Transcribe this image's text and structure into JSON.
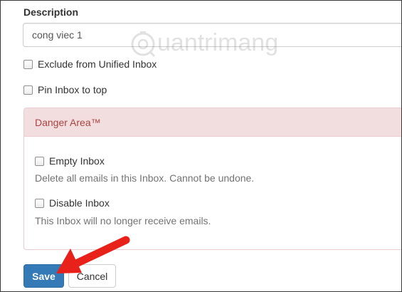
{
  "form": {
    "description_label": "Description",
    "description_value": "cong viec 1",
    "exclude_label": "Exclude from Unified Inbox",
    "pin_label": "Pin Inbox to top"
  },
  "danger": {
    "title": "Danger Area™",
    "empty_label": "Empty Inbox",
    "empty_help": "Delete all emails in this Inbox. Cannot be undone.",
    "disable_label": "Disable Inbox",
    "disable_help": "This Inbox will no longer receive emails."
  },
  "actions": {
    "save_label": "Save",
    "cancel_label": "Cancel"
  },
  "watermark": {
    "text": "uantrimang"
  },
  "colors": {
    "primary": "#337ab7",
    "danger_heading_bg": "#f2dede",
    "danger_text": "#a94442",
    "annotation_arrow": "#e8221b"
  },
  "icons": [
    "watermark-logo-icon",
    "annotation-arrow-icon"
  ]
}
